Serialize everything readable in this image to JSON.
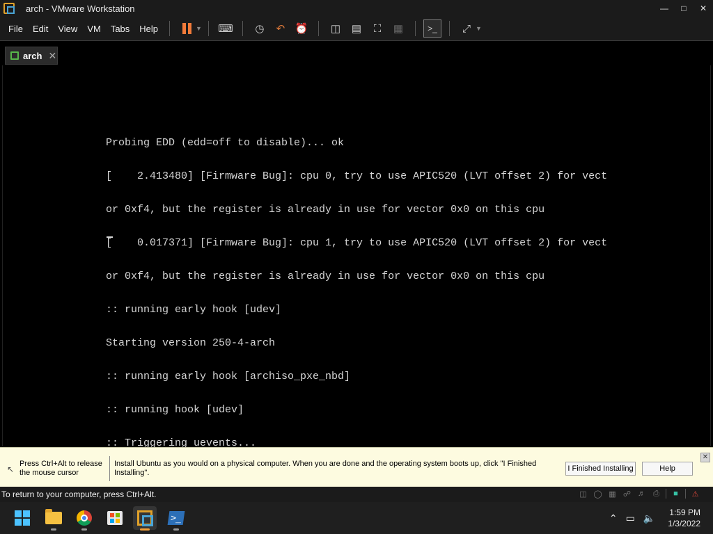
{
  "window": {
    "title": "arch - VMware Workstation",
    "controls": [
      "minimize-icon",
      "maximize-icon",
      "close-icon"
    ]
  },
  "menu": {
    "items": [
      "File",
      "Edit",
      "View",
      "VM",
      "Tabs",
      "Help"
    ]
  },
  "tab": {
    "label": "arch",
    "close": "✕"
  },
  "console": {
    "lines": [
      "Probing EDD (edd=off to disable)... ok",
      "[    2.413480] [Firmware Bug]: cpu 0, try to use APIC520 (LVT offset 2) for vect",
      "or 0xf4, but the register is already in use for vector 0x0 on this cpu",
      "[    0.017371] [Firmware Bug]: cpu 1, try to use APIC520 (LVT offset 2) for vect",
      "or 0xf4, but the register is already in use for vector 0x0 on this cpu",
      ":: running early hook [udev]",
      "Starting version 250-4-arch",
      ":: running early hook [archiso_pxe_nbd]",
      ":: running hook [udev]",
      ":: Triggering uevents..."
    ]
  },
  "hint": {
    "release": "Press Ctrl+Alt to release the mouse cursor",
    "message": "Install Ubuntu as you would on a physical computer. When you are done and the operating system boots up, click \"I Finished Installing\".",
    "finished_button": "I Finished Installing",
    "help_button": "Help",
    "close": "✕"
  },
  "status": {
    "text": "To return to your computer, press Ctrl+Alt."
  },
  "taskbar": {
    "time": "1:59 PM",
    "date": "1/3/2022",
    "apps": [
      "start-icon",
      "file-explorer-icon",
      "chrome-icon",
      "store-icon",
      "vmware-icon",
      "powershell-icon"
    ]
  }
}
